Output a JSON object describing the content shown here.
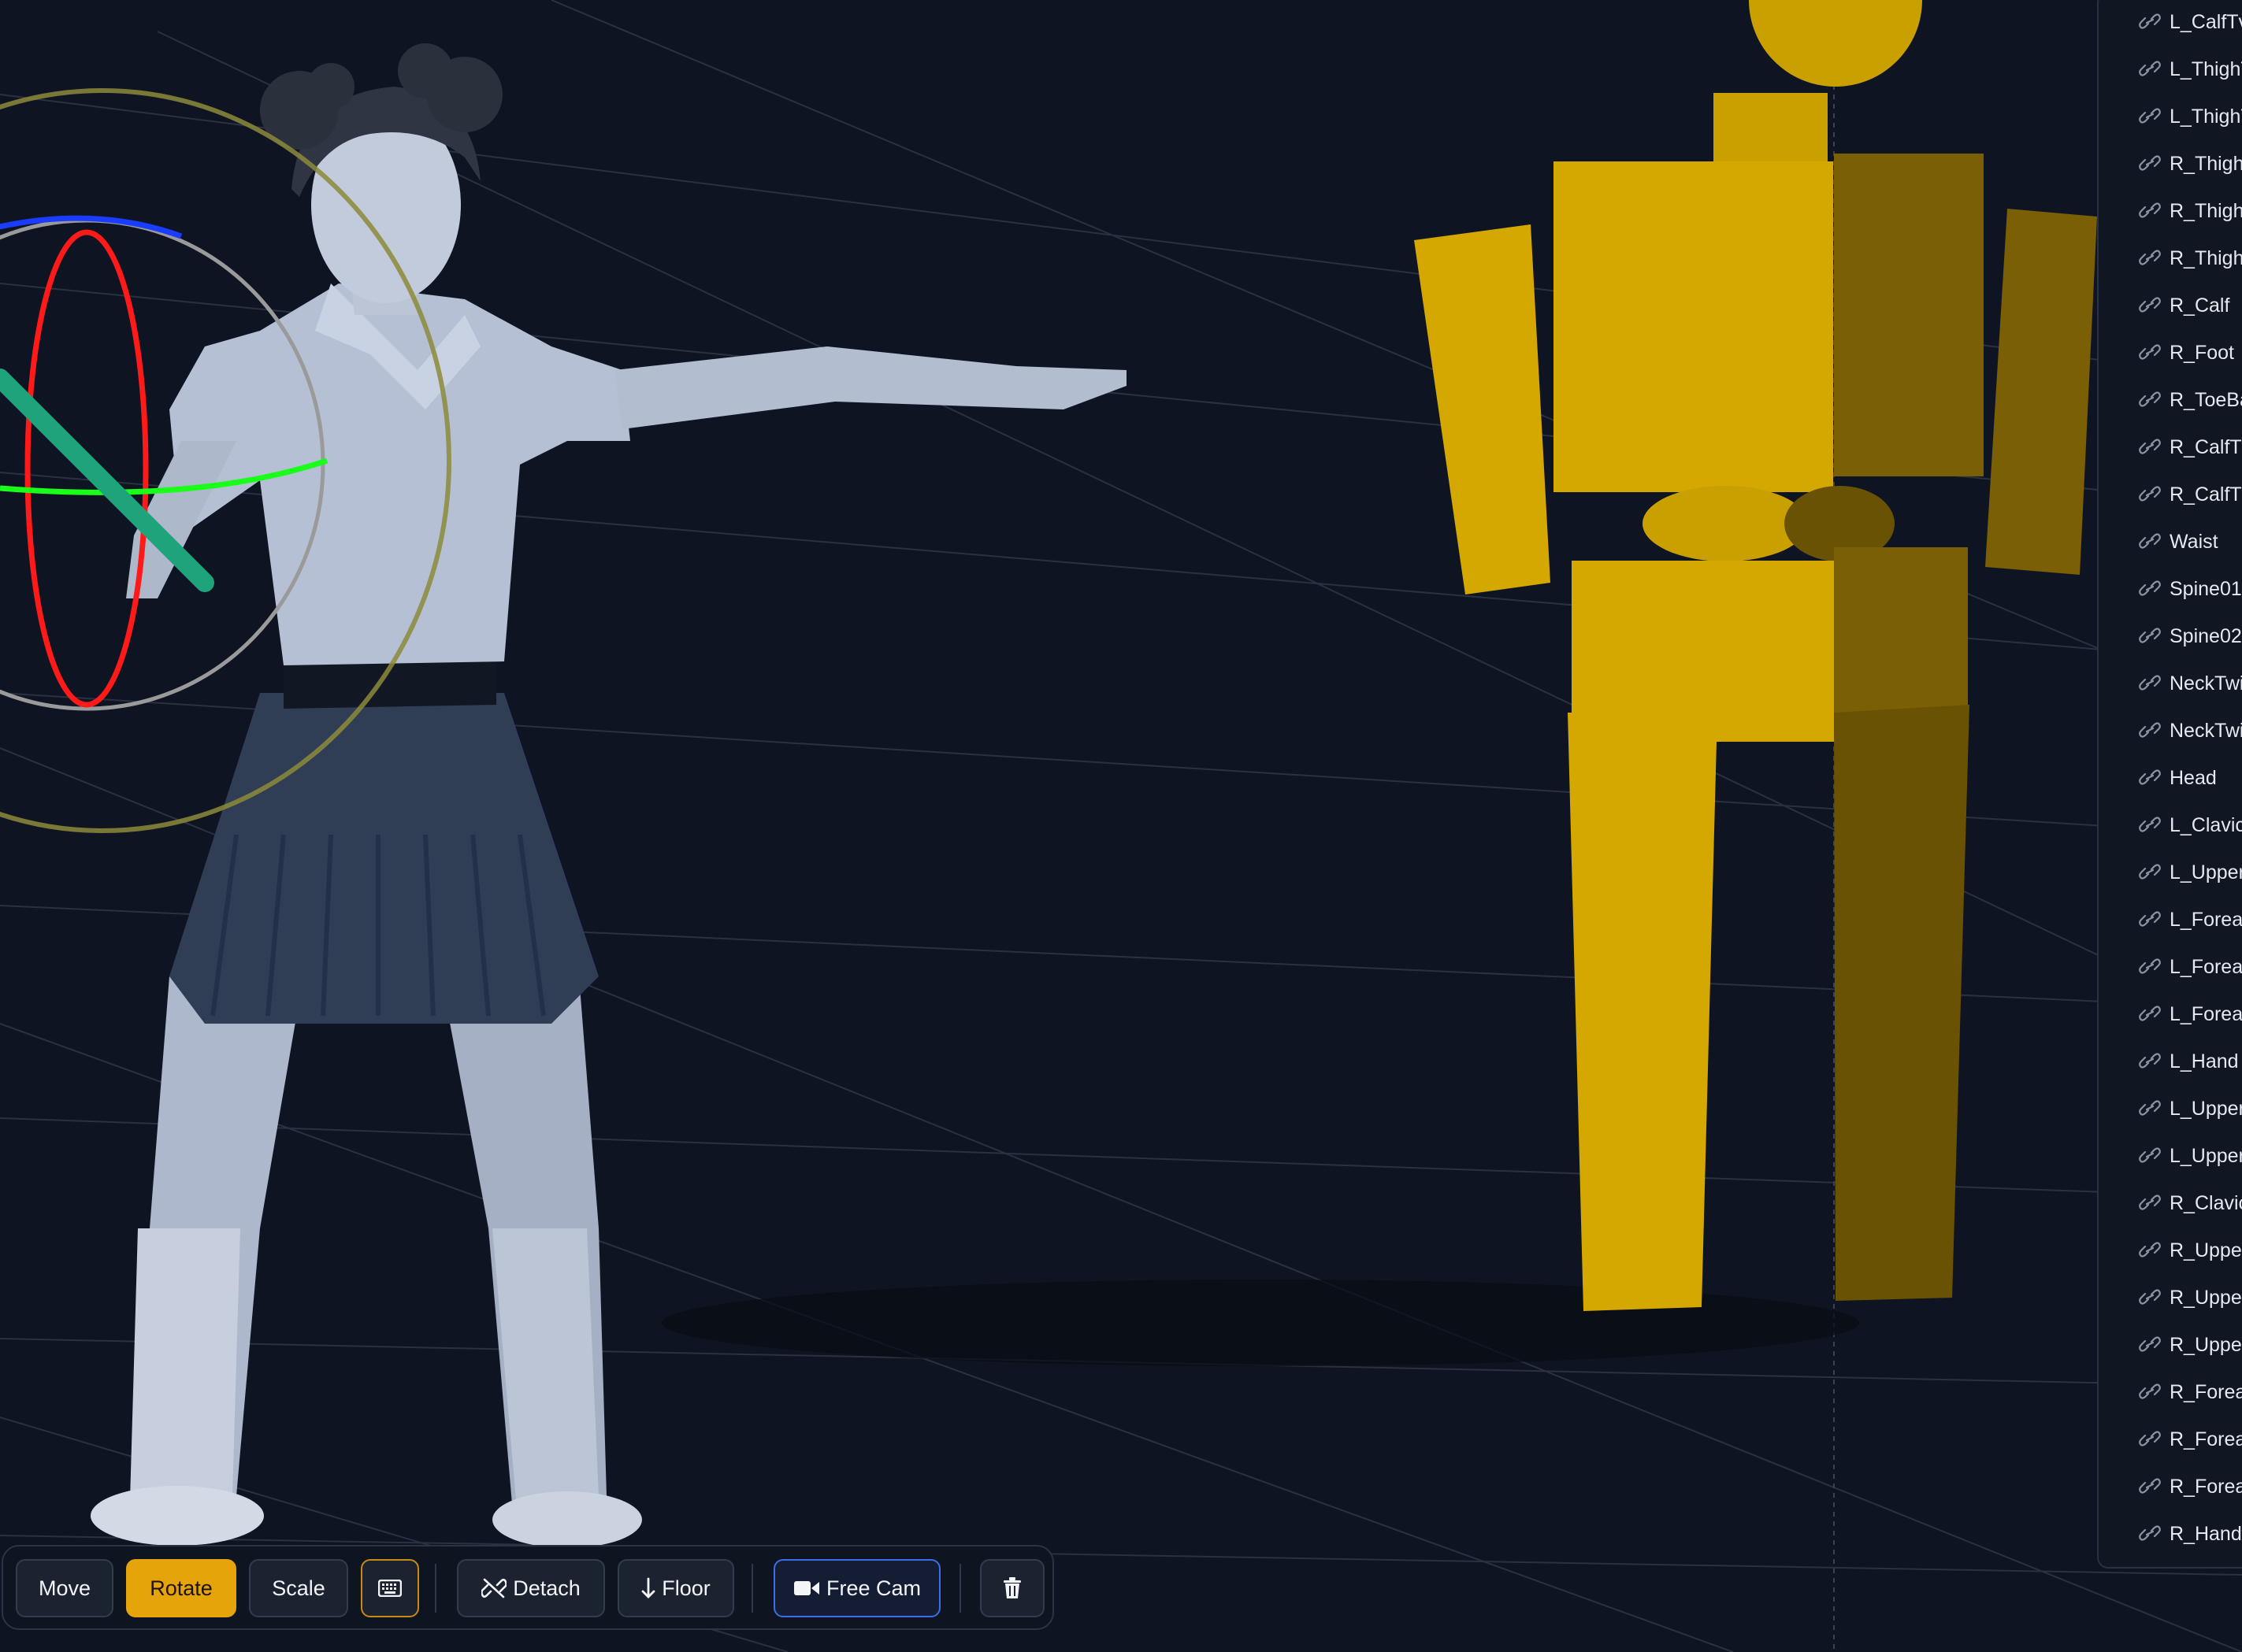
{
  "bone_list": [
    {
      "label": "L_CalfTv",
      "icon": "link-icon"
    },
    {
      "label": "L_ThighT",
      "icon": "link-icon"
    },
    {
      "label": "L_ThighT",
      "icon": "link-icon"
    },
    {
      "label": "R_Thigh",
      "icon": "link-icon"
    },
    {
      "label": "R_ThighT",
      "icon": "link-icon"
    },
    {
      "label": "R_ThighT",
      "icon": "link-icon"
    },
    {
      "label": "R_Calf",
      "icon": "link-icon"
    },
    {
      "label": "R_Foot",
      "icon": "link-icon"
    },
    {
      "label": "R_ToeBa",
      "icon": "link-icon"
    },
    {
      "label": "R_CalfTv",
      "icon": "link-icon"
    },
    {
      "label": "R_CalfTv",
      "icon": "link-icon"
    },
    {
      "label": "Waist",
      "icon": "link-icon"
    },
    {
      "label": "Spine01",
      "icon": "link-icon"
    },
    {
      "label": "Spine02",
      "icon": "link-icon"
    },
    {
      "label": "NeckTwi",
      "icon": "link-icon"
    },
    {
      "label": "NeckTwi",
      "icon": "link-icon"
    },
    {
      "label": "Head",
      "icon": "link-icon"
    },
    {
      "label": "L_Clavic",
      "icon": "link-icon"
    },
    {
      "label": "L_Upper",
      "icon": "link-icon"
    },
    {
      "label": "L_Forear",
      "icon": "link-icon"
    },
    {
      "label": "L_Forear",
      "icon": "link-icon"
    },
    {
      "label": "L_Forear",
      "icon": "link-icon"
    },
    {
      "label": "L_Hand",
      "icon": "link-icon"
    },
    {
      "label": "L_Upper",
      "icon": "link-icon"
    },
    {
      "label": "L_Upper",
      "icon": "link-icon"
    },
    {
      "label": "R_Clavic",
      "icon": "link-icon"
    },
    {
      "label": "R_Upper",
      "icon": "link-icon"
    },
    {
      "label": "R_Upper",
      "icon": "link-icon"
    },
    {
      "label": "R_Upper",
      "icon": "link-icon"
    },
    {
      "label": "R_Forea",
      "icon": "link-icon"
    },
    {
      "label": "R_Forea",
      "icon": "link-icon"
    },
    {
      "label": "R_Forea",
      "icon": "link-icon"
    },
    {
      "label": "R_Hand",
      "icon": "link-icon"
    }
  ],
  "toolbar": {
    "move_label": "Move",
    "rotate_label": "Rotate",
    "scale_label": "Scale",
    "keyboard_icon": "keyboard-icon",
    "detach_label": "Detach",
    "detach_icon": "unlink-icon",
    "floor_label": "Floor",
    "floor_icon": "arrow-down-icon",
    "freecam_label": "Free Cam",
    "freecam_icon": "video-camera-icon",
    "delete_icon": "trash-icon",
    "active_mode": "Rotate"
  },
  "colors": {
    "background": "#0e1422",
    "accent_active": "#e5a50a",
    "freecam_border": "#3b6ee8",
    "bone_proxy": "#c9a000",
    "gizmo_x": "#ff1a1a",
    "gizmo_y": "#1aff1a",
    "gizmo_z": "#1a3cff"
  }
}
